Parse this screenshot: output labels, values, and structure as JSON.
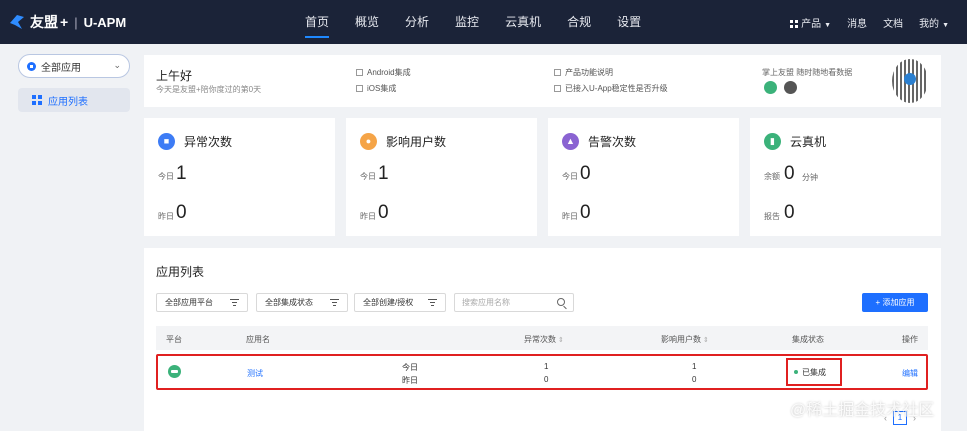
{
  "topbar": {
    "brand": "友盟",
    "brand_plus": "+",
    "sep": "|",
    "product": "U-APM",
    "nav": [
      {
        "label": "首页",
        "active": true
      },
      {
        "label": "概览",
        "active": false
      },
      {
        "label": "分析",
        "active": false
      },
      {
        "label": "监控",
        "active": false
      },
      {
        "label": "云真机",
        "active": false
      },
      {
        "label": "合规",
        "active": false
      },
      {
        "label": "设置",
        "active": false
      }
    ],
    "right": {
      "products": "产品",
      "messages": "消息",
      "docs": "文档",
      "mine": "我的"
    }
  },
  "sidebar": {
    "app_select": "全部应用",
    "items": [
      {
        "label": "应用列表",
        "active": true
      }
    ]
  },
  "greeting": {
    "title": "上午好",
    "subtitle": "今天是友盟+陪你度过的第0天",
    "links": [
      "Android集成",
      "iOS集成",
      "产品功能说明",
      "已接入U-App稳定性是否升级"
    ],
    "qr_caption": "掌上友盟 随时随地看数据"
  },
  "stats": [
    {
      "title": "异常次数",
      "icon": "bug-icon",
      "color": "#3d7cf5",
      "rows": [
        {
          "label": "今日",
          "value": "1"
        },
        {
          "label": "昨日",
          "value": "0"
        }
      ]
    },
    {
      "title": "影响用户数",
      "icon": "users-icon",
      "color": "#f5a447",
      "rows": [
        {
          "label": "今日",
          "value": "1"
        },
        {
          "label": "昨日",
          "value": "0"
        }
      ]
    },
    {
      "title": "告警次数",
      "icon": "alarm-icon",
      "color": "#8a63d2",
      "rows": [
        {
          "label": "今日",
          "value": "0"
        },
        {
          "label": "昨日",
          "value": "0"
        }
      ]
    },
    {
      "title": "云真机",
      "icon": "phone-icon",
      "color": "#3bb27a",
      "rows": [
        {
          "label": "余额",
          "value": "0",
          "unit": "分钟"
        },
        {
          "label": "报告",
          "value": "0"
        }
      ]
    }
  ],
  "applist": {
    "title": "应用列表",
    "filters": [
      "全部应用平台",
      "全部集成状态",
      "全部创建/授权"
    ],
    "search_placeholder": "搜索应用名称",
    "add_button": "+ 添加应用",
    "columns": [
      "平台",
      "应用名",
      "异常次数",
      "影响用户数",
      "集成状态",
      "操作"
    ],
    "sort_glyph": "⇕",
    "rows": [
      {
        "platform": "android-icon",
        "name": "测试",
        "period_today": "今日",
        "period_yesterday": "昨日",
        "crash_today": "1",
        "crash_yesterday": "0",
        "users_today": "1",
        "users_yesterday": "0",
        "status": "已集成",
        "action": "编辑"
      }
    ],
    "pager": {
      "prev": "‹",
      "current": "1",
      "next": "›"
    }
  },
  "watermark": "@稀土掘金技术社区"
}
